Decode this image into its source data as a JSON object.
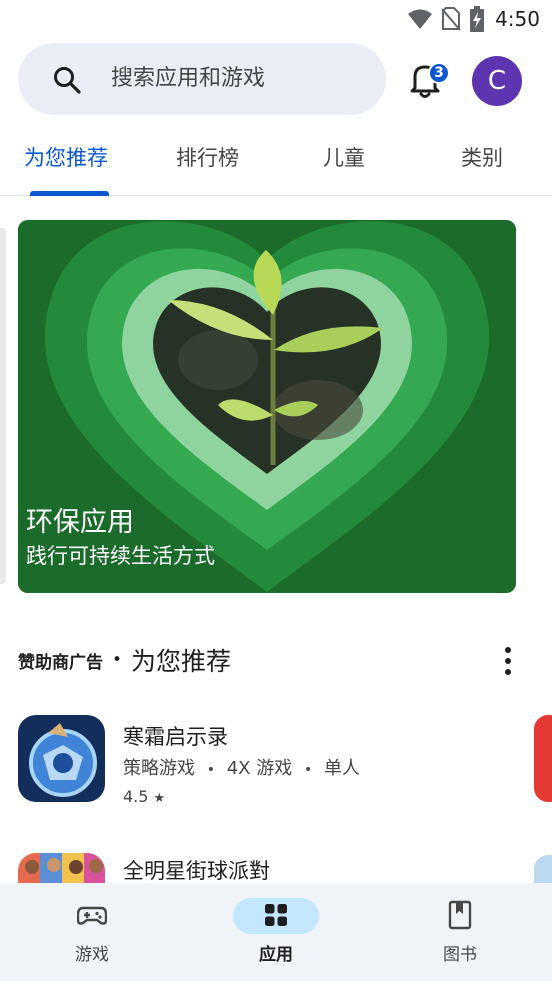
{
  "status": {
    "time": "4:50"
  },
  "search": {
    "placeholder": "搜索应用和游戏"
  },
  "notifications": {
    "count": "3"
  },
  "account": {
    "initial": "C"
  },
  "tabs": [
    {
      "label": "为您推荐",
      "active": true
    },
    {
      "label": "排行榜"
    },
    {
      "label": "儿童"
    },
    {
      "label": "类别"
    }
  ],
  "hero": {
    "title": "环保应用",
    "subtitle": "践行可持续生活方式"
  },
  "section": {
    "ad_label": "赞助商广告",
    "separator": "•",
    "title": "为您推荐"
  },
  "apps": [
    {
      "name": "寒霜启示录",
      "category": "策略游戏",
      "sep1": "•",
      "tag": "4X 游戏",
      "sep2": "•",
      "mode": "单人",
      "rating": "4.5",
      "star": "★"
    },
    {
      "name": "全明星街球派對"
    }
  ],
  "bottom_nav": [
    {
      "label": "游戏",
      "icon": "gamepad-icon"
    },
    {
      "label": "应用",
      "icon": "apps-grid-icon",
      "active": true
    },
    {
      "label": "图书",
      "icon": "bookmark-book-icon"
    }
  ],
  "colors": {
    "accent": "#0b57d0",
    "avatar": "#5e35b1",
    "search_bg": "#e9eef6",
    "hero_green": "#1b6b2b",
    "nav_active": "#c2e7ff"
  }
}
